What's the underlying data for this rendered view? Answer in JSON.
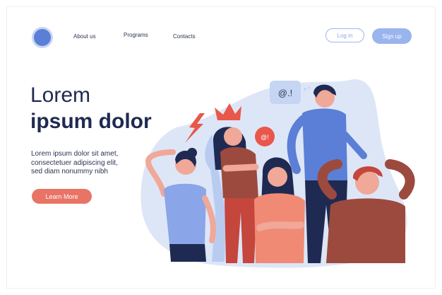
{
  "header": {
    "nav": [
      {
        "label": "About us"
      },
      {
        "label": "Programs"
      },
      {
        "label": "Contacts"
      }
    ],
    "login_label": "Log in",
    "signup_label": "Sign up"
  },
  "hero": {
    "title_line1": "Lorem",
    "title_line2": "ipsum dolor",
    "body_lines": [
      "Lorem ipsum dolor sit amet,",
      "consectetuer adipiscing elit,",
      "sed diam nonummy nibh"
    ],
    "cta_label": "Learn More"
  },
  "illustration": {
    "speech_bubble_1": "@.!",
    "speech_bubble_2": "@!"
  },
  "colors": {
    "primary": "#5b7fd6",
    "accent": "#e87466",
    "text": "#1f2a52"
  }
}
